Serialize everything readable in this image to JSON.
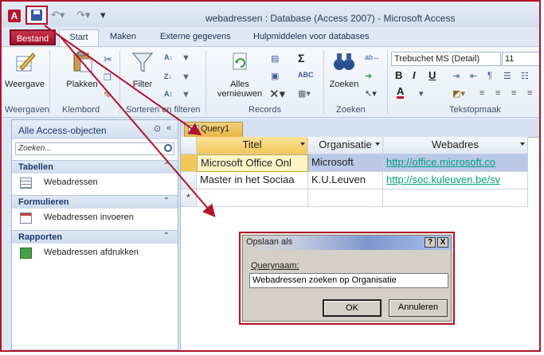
{
  "window": {
    "title": "webadressen : Database (Access 2007)  -  Microsoft Access",
    "app_icon": "A"
  },
  "quick_access": {
    "save_icon": "save-disk-icon",
    "undo_icon": "undo-icon",
    "redo_icon": "redo-icon",
    "customize_icon": "customize-icon"
  },
  "tabs": {
    "file": "Bestand",
    "start": "Start",
    "create": "Maken",
    "external": "Externe gegevens",
    "tools": "Hulpmiddelen voor databases"
  },
  "ribbon": {
    "view_label": "Weergave",
    "paste_label": "Plakken",
    "filter_label": "Filter",
    "refresh_label": "Alles\nvernieuwen",
    "find_label": "Zoeken",
    "groups": {
      "views": "Weergaven",
      "clipboard": "Klembord",
      "sort_filter": "Sorteren en filteren",
      "records": "Records",
      "find": "Zoeken",
      "text": "Tekstopmaak"
    },
    "font_name": "Trebuchet MS (Detail)",
    "font_size": "11",
    "sigma": "Σ",
    "bold": "B",
    "italic": "I",
    "underline": "U",
    "font_color": "A",
    "accent": "#c0142c"
  },
  "nav": {
    "title": "Alle Access-objecten",
    "search_placeholder": "Zoeken...",
    "groups": [
      {
        "label": "Tabellen",
        "items": [
          "Webadressen"
        ]
      },
      {
        "label": "Formulieren",
        "items": [
          "Webadressen invoeren"
        ]
      },
      {
        "label": "Rapporten",
        "items": [
          "Webadressen afdrukken"
        ]
      }
    ]
  },
  "query": {
    "tab": "Query1",
    "columns": [
      "Titel",
      "Organisatie",
      "Webadres"
    ],
    "rows": [
      [
        "Microsoft Office Onl",
        "Microsoft",
        "http://office.microsoft.co"
      ],
      [
        "Master in het Sociaa",
        "K.U.Leuven",
        "http://soc.kuleuven.be/sv"
      ]
    ],
    "new_row_marker": "*"
  },
  "dialog": {
    "title": "Opslaan als",
    "help": "?",
    "close": "X",
    "label": "Querynaam:",
    "value": "Webadressen zoeken op Organisatie",
    "ok": "OK",
    "cancel": "Annuleren"
  }
}
